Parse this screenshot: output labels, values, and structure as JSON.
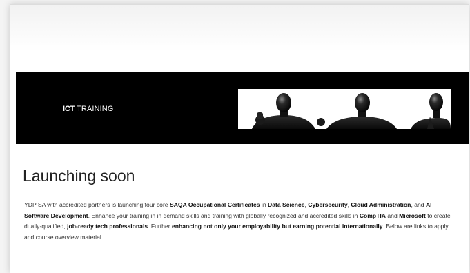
{
  "header": {
    "divider": ""
  },
  "banner": {
    "label_bold": "ICT",
    "label_rest": " TRAINING",
    "image_icon": "robot-figures-image"
  },
  "content": {
    "headline": "Launching soon",
    "paragraph": [
      {
        "text": "YDP SA with accredited partners is launching four core ",
        "bold": false
      },
      {
        "text": "SAQA Occupational Certificates",
        "bold": true
      },
      {
        "text": " in ",
        "bold": false
      },
      {
        "text": "Data Science",
        "bold": true
      },
      {
        "text": ", ",
        "bold": false
      },
      {
        "text": "Cybersecurity",
        "bold": true
      },
      {
        "text": ", ",
        "bold": false
      },
      {
        "text": "Cloud Administration",
        "bold": true
      },
      {
        "text": ", and ",
        "bold": false
      },
      {
        "text": "AI Software Development",
        "bold": true
      },
      {
        "text": ". Enhance your training in in demand skills and training  with globally recognized and accredited skills in ",
        "bold": false
      },
      {
        "text": "CompTIA",
        "bold": true
      },
      {
        "text": " and ",
        "bold": false
      },
      {
        "text": "Microsoft",
        "bold": true
      },
      {
        "text": " to create dually-qualified, ",
        "bold": false
      },
      {
        "text": "job-ready tech professionals",
        "bold": true
      },
      {
        "text": ". Further ",
        "bold": false
      },
      {
        "text": "enhancing not only your employability but earning potential internationally",
        "bold": true
      },
      {
        "text": ". Below are links to apply and course overview material.",
        "bold": false
      }
    ]
  },
  "colors": {
    "banner_background": "#000000",
    "page_background": "#ffffff",
    "text": "#333333"
  }
}
